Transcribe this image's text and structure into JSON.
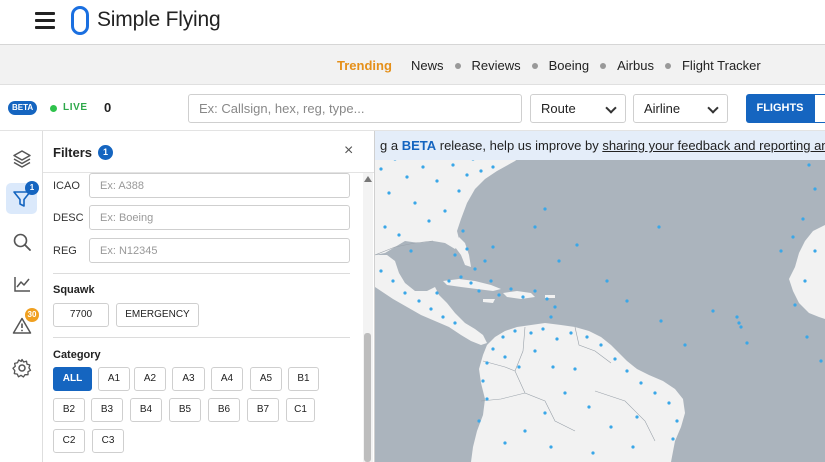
{
  "header": {
    "logo_text": "Simple Flying"
  },
  "nav": {
    "trending": "Trending",
    "items": [
      "News",
      "Reviews",
      "Boeing",
      "Airbus",
      "Flight Tracker"
    ]
  },
  "toolbar": {
    "beta": "BETA",
    "live": "LIVE",
    "live_count": "0",
    "search_placeholder": "Ex: Callsign, hex, reg, type...",
    "route": "Route",
    "airline": "Airline",
    "flights": "FLIGHTS"
  },
  "rail": {
    "filter_badge": "1",
    "alerts_badge": "30"
  },
  "filters": {
    "title": "Filters",
    "count": "1",
    "close": "×",
    "fields": [
      {
        "label": "ICAO",
        "placeholder": "Ex: A388"
      },
      {
        "label": "DESC",
        "placeholder": "Ex: Boeing"
      },
      {
        "label": "REG",
        "placeholder": "Ex: N12345"
      }
    ],
    "squawk": {
      "title": "Squawk",
      "buttons": [
        "7700",
        "EMERGENCY"
      ]
    },
    "category": {
      "title": "Category",
      "options": [
        "ALL",
        "A1",
        "A2",
        "A3",
        "A4",
        "A5",
        "B1",
        "B2",
        "B3",
        "B4",
        "B5",
        "B6",
        "B7",
        "C1",
        "C2",
        "C3"
      ],
      "selected": "ALL"
    }
  },
  "banner": {
    "prefix": "g a ",
    "beta": "BETA",
    "middle": " release, help us improve by ",
    "link": "sharing your feedback and reporting any bugs"
  },
  "colors": {
    "accent": "#1565c0",
    "trending": "#e5901a",
    "live": "#2ec24c",
    "alert_badge": "#f0a020",
    "map_water": "#abb4bd",
    "map_land": "#f2f2f2",
    "aircraft_dot": "#3aa7e8"
  },
  "icons": [
    "hamburger-icon",
    "layers-icon",
    "filter-icon",
    "search-icon",
    "chart-icon",
    "alert-icon",
    "gear-icon",
    "chevron-down-icon",
    "close-icon"
  ]
}
